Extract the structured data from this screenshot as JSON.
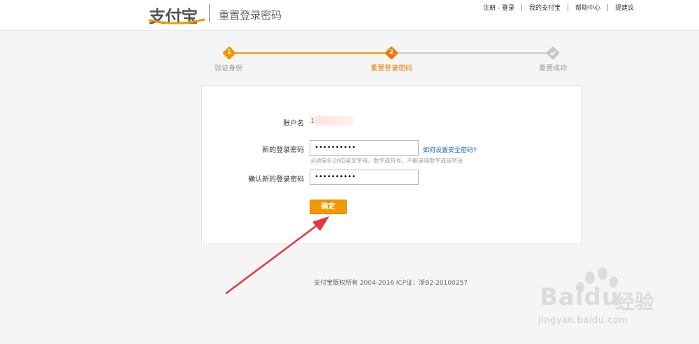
{
  "header": {
    "logo_text": "支付宝",
    "page_title": "重置登录密码",
    "links": [
      "注册 - 登录",
      "我的支付宝",
      "帮助中心",
      "提建议"
    ]
  },
  "steps": [
    {
      "number": "1",
      "label": "验证身份",
      "state": "done"
    },
    {
      "number": "2",
      "label": "重置登录密码",
      "state": "current"
    },
    {
      "number": "",
      "label": "重置成功",
      "state": "todo"
    }
  ],
  "form": {
    "account_label": "账户名",
    "account_value": "1",
    "new_password_label": "新的登录密码",
    "new_password_value": "••••••••••",
    "help_link": "如何设置安全密码?",
    "hint": "必须是8-20位英文字母，数字或符号，不能是纯数字或纯字母",
    "confirm_password_label": "确认新的登录密码",
    "confirm_password_value": "••••••••••",
    "submit_label": "确定"
  },
  "footer": {
    "copyright": "支付宝版权所有 2004-2016 ICP证：浙B2-20100257"
  },
  "watermark": {
    "brand": "Bai",
    "brand2": "du",
    "cn": "经验",
    "url": "jingyan.baidu.com"
  },
  "colors": {
    "accent": "#f39800",
    "active_step_text": "#f07a00",
    "link": "#0d6ab3",
    "annotation_arrow": "#e8343a"
  }
}
